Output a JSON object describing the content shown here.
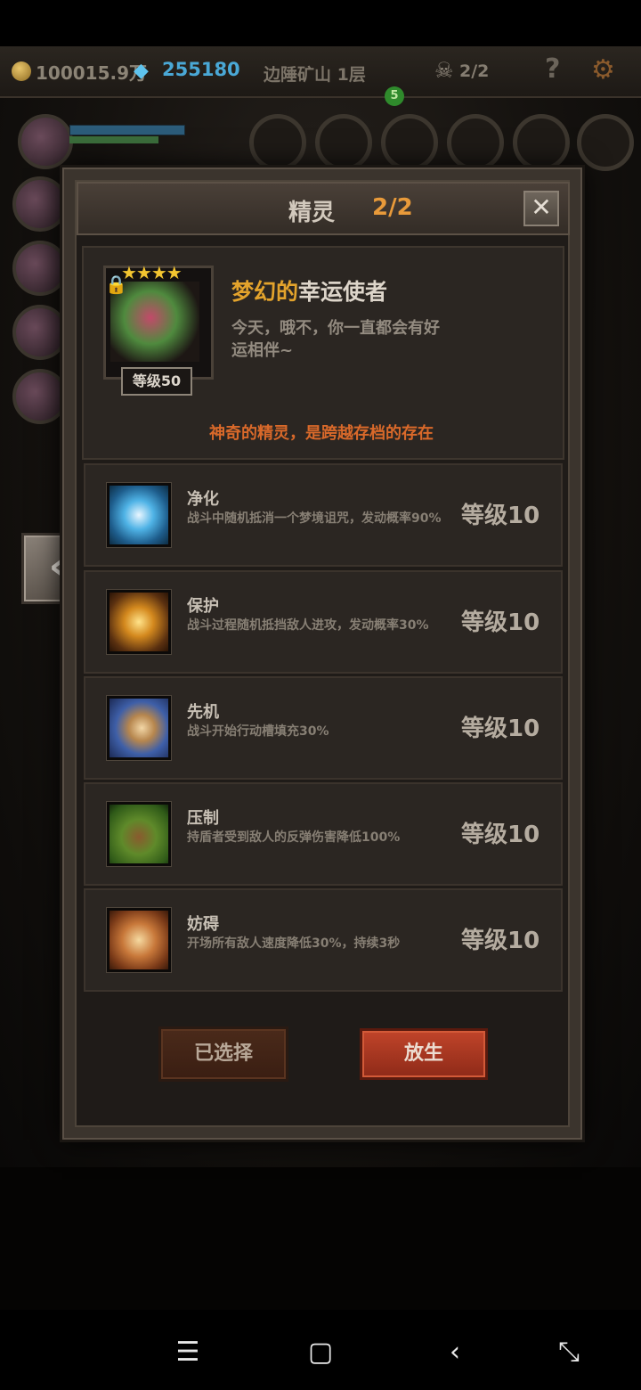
{
  "hud": {
    "gold": "100015.9万",
    "gems": "255180",
    "location": "边陲矿山 1层",
    "skull_count": "2/2",
    "help_label": "?",
    "notify_badge": "5"
  },
  "dialog": {
    "title": "精灵",
    "count": "2/2",
    "close_label": "✕"
  },
  "spirit": {
    "stars": "★★★★",
    "level": "等级50",
    "name_prefix": "梦幻的",
    "name": "幸运使者",
    "description": "今天，哦不，你一直都会有好运相伴~",
    "note": "神奇的精灵，是跨越存档的存在"
  },
  "skills": [
    {
      "name": "净化",
      "description": "战斗中随机抵消一个梦境诅咒，发动概率90%",
      "level": "等级10",
      "icon": "flower-icon"
    },
    {
      "name": "保护",
      "description": "战斗过程随机抵挡敌人进攻，发动概率30%",
      "level": "等级10",
      "icon": "shield-fairy-icon"
    },
    {
      "name": "先机",
      "description": "战斗开始行动槽填充30%",
      "level": "等级10",
      "icon": "leopard-icon"
    },
    {
      "name": "压制",
      "description": "持盾者受到敌人的反弹伤害降低100%",
      "level": "等级10",
      "icon": "claw-icon"
    },
    {
      "name": "妨碍",
      "description": "开场所有敌人速度降低30%，持续3秒",
      "level": "等级10",
      "icon": "chained-boot-icon"
    }
  ],
  "buttons": {
    "selected_label": "已选择",
    "release_label": "放生",
    "back_label": "‹"
  },
  "navbar": {
    "menu": "☰",
    "home": "▢",
    "back": "‹",
    "rotate": "⤡"
  }
}
